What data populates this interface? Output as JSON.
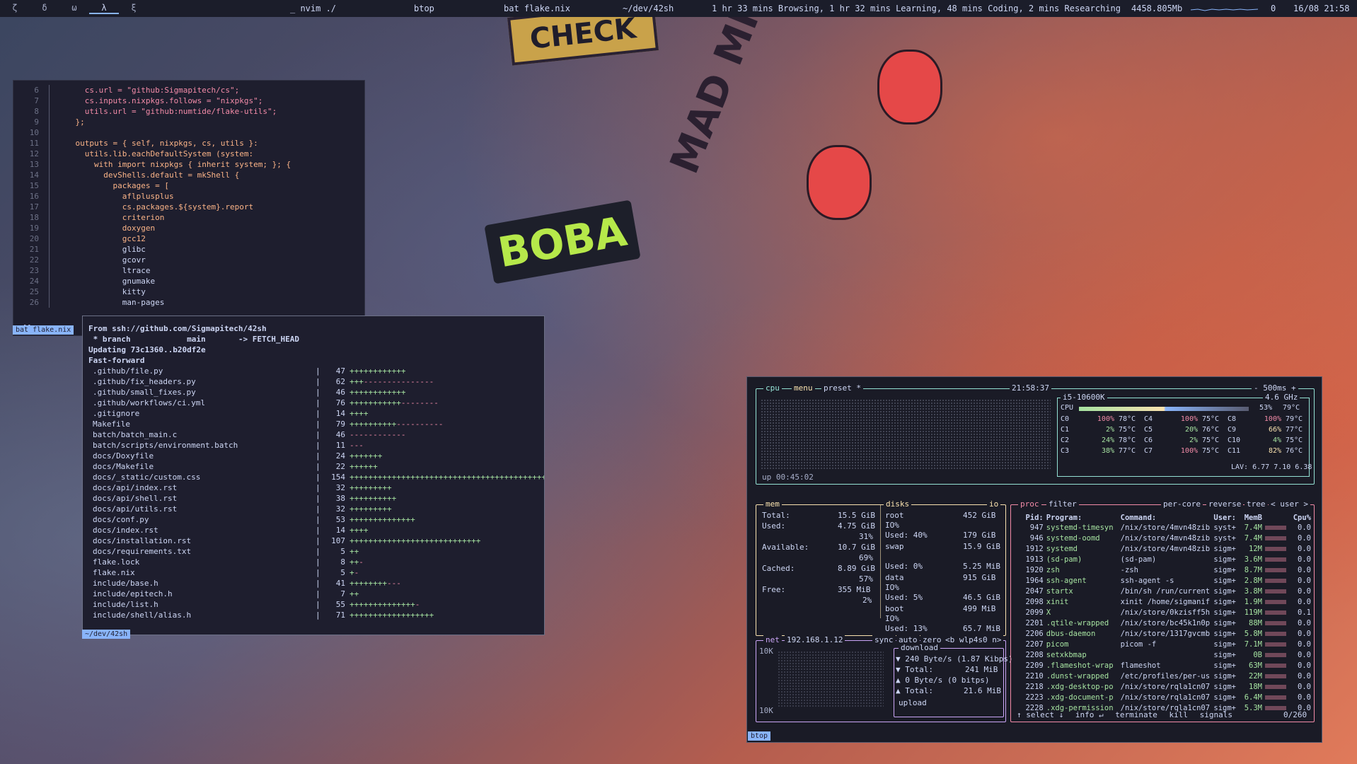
{
  "topbar": {
    "workspaces": [
      "ζ",
      "δ",
      "ω",
      "λ",
      "ξ"
    ],
    "active_workspace": 3,
    "window_titles": [
      "_ nvim ./",
      "btop",
      "bat flake.nix",
      "~/dev/42sh"
    ],
    "activity": "1 hr 33 mins Browsing, 1 hr 32 mins Learning, 48 mins Coding, 2 mins Researching",
    "memory": "4458.805Mb",
    "count": "0",
    "datetime": "16/08 21:58"
  },
  "wallpaper": {
    "check": "CHECK",
    "boba": "BOBA",
    "madmilk": "MAD MILK"
  },
  "nvim": {
    "status_label": "bat flake.nix",
    "cmdline": ":[]",
    "lines": [
      {
        "n": "6",
        "t": "      cs.url = \"github:Sigmapitech/cs\";"
      },
      {
        "n": "7",
        "t": "      cs.inputs.nixpkgs.follows = \"nixpkgs\";"
      },
      {
        "n": "8",
        "t": "      utils.url = \"github:numtide/flake-utils\";"
      },
      {
        "n": "9",
        "t": "    };"
      },
      {
        "n": "10",
        "t": ""
      },
      {
        "n": "11",
        "t": "    outputs = { self, nixpkgs, cs, utils }:"
      },
      {
        "n": "12",
        "t": "      utils.lib.eachDefaultSystem (system:"
      },
      {
        "n": "13",
        "t": "        with import nixpkgs { inherit system; }; {"
      },
      {
        "n": "14",
        "t": "          devShells.default = mkShell {"
      },
      {
        "n": "15",
        "t": "            packages = ["
      },
      {
        "n": "16",
        "t": "              aflplusplus"
      },
      {
        "n": "17",
        "t": "              cs.packages.${system}.report"
      },
      {
        "n": "18",
        "t": "              criterion"
      },
      {
        "n": "19",
        "t": "              doxygen"
      },
      {
        "n": "20",
        "t": "              gcc12"
      },
      {
        "n": "21",
        "t": "              glibc"
      },
      {
        "n": "22",
        "t": "              gcovr"
      },
      {
        "n": "23",
        "t": "              ltrace"
      },
      {
        "n": "24",
        "t": "              gnumake"
      },
      {
        "n": "25",
        "t": "              kitty"
      },
      {
        "n": "26",
        "t": "              man-pages"
      }
    ]
  },
  "git": {
    "status_label": "~/dev/42sh",
    "header": [
      "From ssh://github.com/Sigmapitech/42sh",
      " * branch            main       -> FETCH_HEAD",
      "Updating 73c1360..b20df2e",
      "Fast-forward"
    ],
    "files": [
      {
        "f": ".github/file.py",
        "c": "47",
        "p": "++++++++++++",
        "m": ""
      },
      {
        "f": ".github/fix_headers.py",
        "c": "62",
        "p": "+++",
        "m": "---------------"
      },
      {
        "f": ".github/small_fixes.py",
        "c": "46",
        "p": "++++++++++++",
        "m": ""
      },
      {
        "f": ".github/workflows/ci.yml",
        "c": "76",
        "p": "+++++++++++",
        "m": "--------"
      },
      {
        "f": ".gitignore",
        "c": "14",
        "p": "++++",
        "m": ""
      },
      {
        "f": "Makefile",
        "c": "79",
        "p": "++++++++++",
        "m": "----------"
      },
      {
        "f": "batch/batch_main.c",
        "c": "46",
        "p": "",
        "m": "------------"
      },
      {
        "f": "batch/scripts/environment.batch",
        "c": "11",
        "p": "",
        "m": "---"
      },
      {
        "f": "docs/Doxyfile",
        "c": "24",
        "p": "+++++++",
        "m": ""
      },
      {
        "f": "docs/Makefile",
        "c": "22",
        "p": "++++++",
        "m": ""
      },
      {
        "f": "docs/_static/custom.css",
        "c": "154",
        "p": "++++++++++++++++++++++++++++++++++++++++++",
        "m": ""
      },
      {
        "f": "docs/api/index.rst",
        "c": "32",
        "p": "+++++++++",
        "m": ""
      },
      {
        "f": "docs/api/shell.rst",
        "c": "38",
        "p": "++++++++++",
        "m": ""
      },
      {
        "f": "docs/api/utils.rst",
        "c": "32",
        "p": "+++++++++",
        "m": ""
      },
      {
        "f": "docs/conf.py",
        "c": "53",
        "p": "++++++++++++++",
        "m": ""
      },
      {
        "f": "docs/index.rst",
        "c": "14",
        "p": "++++",
        "m": ""
      },
      {
        "f": "docs/installation.rst",
        "c": "107",
        "p": "++++++++++++++++++++++++++++",
        "m": ""
      },
      {
        "f": "docs/requirements.txt",
        "c": "5",
        "p": "++",
        "m": ""
      },
      {
        "f": "flake.lock",
        "c": "8",
        "p": "++",
        "m": "-"
      },
      {
        "f": "flake.nix",
        "c": "5",
        "p": "+",
        "m": "-"
      },
      {
        "f": "include/base.h",
        "c": "41",
        "p": "++++++++",
        "m": "---"
      },
      {
        "f": "include/epitech.h",
        "c": "7",
        "p": "++",
        "m": ""
      },
      {
        "f": "include/list.h",
        "c": "55",
        "p": "++++++++++++++",
        "m": "-"
      },
      {
        "f": "include/shell/alias.h",
        "c": "71",
        "p": "++++++++++++++++++",
        "m": ""
      }
    ]
  },
  "btop": {
    "status_label": "btop",
    "cpu_box": {
      "tabs": [
        "cpu",
        "menu",
        "preset *"
      ],
      "clock": "21:58:37",
      "interval": "- 500ms +",
      "uptime": "up 00:45:02",
      "model": "i5-10600K",
      "freq": "4.6 GHz",
      "total_label": "CPU",
      "total_pct": "53%",
      "total_temp": "79°C",
      "cores": [
        {
          "c": "C0",
          "p": "100%",
          "t": "78°C"
        },
        {
          "c": "C4",
          "p": "100%",
          "t": "75°C"
        },
        {
          "c": "C8",
          "p": "100%",
          "t": "79°C"
        },
        {
          "c": "C1",
          "p": "2%",
          "t": "75°C"
        },
        {
          "c": "C5",
          "p": "20%",
          "t": "76°C"
        },
        {
          "c": "C9",
          "p": "66%",
          "t": "77°C"
        },
        {
          "c": "C2",
          "p": "24%",
          "t": "78°C"
        },
        {
          "c": "C6",
          "p": "2%",
          "t": "75°C"
        },
        {
          "c": "C10",
          "p": "4%",
          "t": "75°C"
        },
        {
          "c": "C3",
          "p": "38%",
          "t": "77°C"
        },
        {
          "c": "C7",
          "p": "100%",
          "t": "75°C"
        },
        {
          "c": "C11",
          "p": "82%",
          "t": "76°C"
        }
      ],
      "load_avg": "LAV: 6.77 7.10 6.38"
    },
    "mem": {
      "title": "mem",
      "disks_title": "disks",
      "io": "io",
      "total": "Total:",
      "total_v": "15.5 GiB",
      "used": "Used:",
      "used_v": "4.75 GiB",
      "used_pct": "31%",
      "available": "Available:",
      "available_v": "10.7 GiB",
      "available_pct": "69%",
      "cached": "Cached:",
      "cached_v": "8.89 GiB",
      "cached_pct": "57%",
      "free": "Free:",
      "free_v": "355 MiB",
      "free_pct": "2%",
      "disks": [
        {
          "name": "root",
          "size": "452 GiB",
          "io": "IO%",
          "used": "Used: 40%",
          "used_v": "179 GiB"
        },
        {
          "name": "swap",
          "size": "15.9 GiB",
          "io": "",
          "used": "Used:  0%",
          "used_v": "5.25 MiB"
        },
        {
          "name": "data",
          "size": "915 GiB",
          "io": "IO%",
          "used": "Used:  5%",
          "used_v": "46.5 GiB"
        },
        {
          "name": "boot",
          "size": "499 MiB",
          "io": "IO%",
          "used": "Used: 13%",
          "used_v": "65.7 MiB"
        }
      ]
    },
    "net": {
      "title": "net",
      "ip": "192.168.1.12",
      "tabs": [
        "sync",
        "auto",
        "zero",
        "<b wlp4s0 n>"
      ],
      "scale_top": "10K",
      "scale_bottom": "10K",
      "download": "download",
      "down_rate": "▼ 240 Byte/s (1.87 Kibps)",
      "down_total": "▼ Total:",
      "down_total_v": "241 MiB",
      "up_rate": "▲ 0 Byte/s      (0 bitps)",
      "up_total": "▲ Total:",
      "up_total_v": "21.6 MiB",
      "upload": "upload"
    },
    "proc": {
      "title": "proc",
      "tabs": [
        "filter",
        "per-core",
        "reverse",
        "tree",
        "< user >"
      ],
      "headers": [
        "Pid:",
        "Program:",
        "Command:",
        "User:",
        "MemB",
        "",
        "Cpu%"
      ],
      "rows": [
        {
          "pid": "947",
          "prog": "systemd-timesyn",
          "cmd": "/nix/store/4mvn48zib",
          "user": "syst+",
          "mem": "7.4M",
          "cpu": "0.0"
        },
        {
          "pid": "946",
          "prog": "systemd-oomd",
          "cmd": "/nix/store/4mvn48zib",
          "user": "syst+",
          "mem": "7.4M",
          "cpu": "0.0"
        },
        {
          "pid": "1912",
          "prog": "systemd",
          "cmd": "/nix/store/4mvn48zib",
          "user": "sigm+",
          "mem": "12M",
          "cpu": "0.0"
        },
        {
          "pid": "1913",
          "prog": "(sd-pam)",
          "cmd": "(sd-pam)",
          "user": "sigm+",
          "mem": "3.6M",
          "cpu": "0.0"
        },
        {
          "pid": "1920",
          "prog": "zsh",
          "cmd": "-zsh",
          "user": "sigm+",
          "mem": "8.7M",
          "cpu": "0.0"
        },
        {
          "pid": "1964",
          "prog": "ssh-agent",
          "cmd": "ssh-agent -s",
          "user": "sigm+",
          "mem": "2.8M",
          "cpu": "0.0"
        },
        {
          "pid": "2047",
          "prog": "startx",
          "cmd": "/bin/sh /run/current",
          "user": "sigm+",
          "mem": "3.8M",
          "cpu": "0.0"
        },
        {
          "pid": "2098",
          "prog": "xinit",
          "cmd": "xinit /home/sigmanif",
          "user": "sigm+",
          "mem": "1.9M",
          "cpu": "0.0"
        },
        {
          "pid": "2099",
          "prog": "X",
          "cmd": "/nix/store/0kzisff5h",
          "user": "sigm+",
          "mem": "119M",
          "cpu": "0.1"
        },
        {
          "pid": "2201",
          "prog": ".qtile-wrapped",
          "cmd": "/nix/store/bc45k1n0p",
          "user": "sigm+",
          "mem": "88M",
          "cpu": "0.0"
        },
        {
          "pid": "2206",
          "prog": "dbus-daemon",
          "cmd": "/nix/store/1317gvcmb",
          "user": "sigm+",
          "mem": "5.8M",
          "cpu": "0.0"
        },
        {
          "pid": "2207",
          "prog": "picom",
          "cmd": "picom -f",
          "user": "sigm+",
          "mem": "7.1M",
          "cpu": "0.0"
        },
        {
          "pid": "2208",
          "prog": "setxkbmap",
          "cmd": "",
          "user": "sigm+",
          "mem": "0B",
          "cpu": "0.0"
        },
        {
          "pid": "2209",
          "prog": ".flameshot-wrap",
          "cmd": "flameshot",
          "user": "sigm+",
          "mem": "63M",
          "cpu": "0.0"
        },
        {
          "pid": "2210",
          "prog": ".dunst-wrapped",
          "cmd": "/etc/profiles/per-us",
          "user": "sigm+",
          "mem": "22M",
          "cpu": "0.0"
        },
        {
          "pid": "2218",
          "prog": ".xdg-desktop-po",
          "cmd": "/nix/store/rqla1cn07",
          "user": "sigm+",
          "mem": "18M",
          "cpu": "0.0"
        },
        {
          "pid": "2223",
          "prog": ".xdg-document-p",
          "cmd": "/nix/store/rqla1cn07",
          "user": "sigm+",
          "mem": "6.4M",
          "cpu": "0.0"
        },
        {
          "pid": "2228",
          "prog": ".xdg-permission",
          "cmd": "/nix/store/rqla1cn07",
          "user": "sigm+",
          "mem": "5.3M",
          "cpu": "0.0"
        }
      ],
      "footer": [
        "↑ select ↓",
        "info ↵",
        "terminate",
        "kill",
        "signals"
      ],
      "count": "0/260"
    }
  }
}
